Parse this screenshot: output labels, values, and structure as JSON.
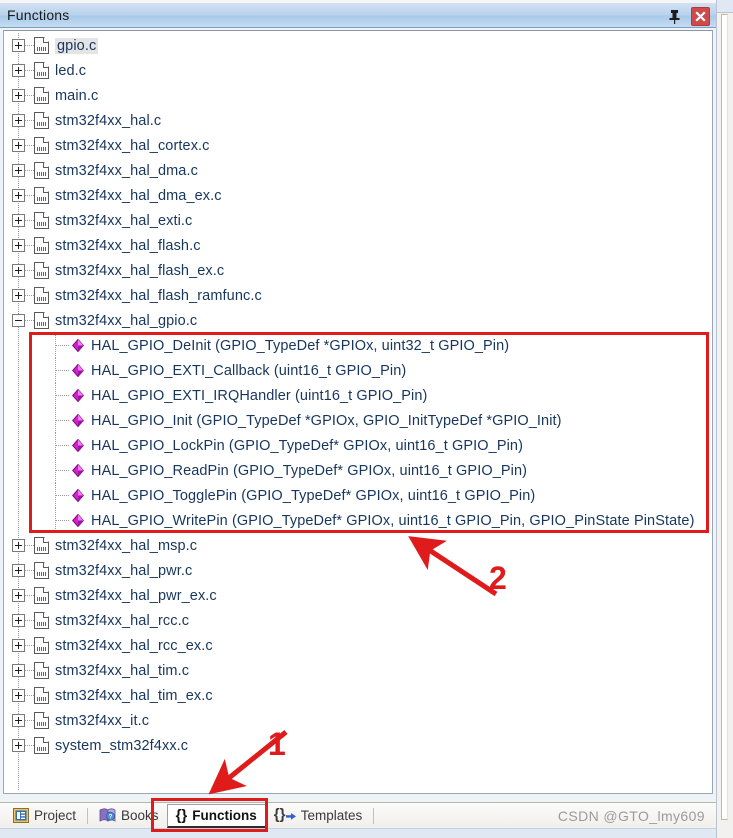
{
  "window": {
    "title": "Functions",
    "pin_icon": "pin-icon",
    "close_icon": "close-icon"
  },
  "tree": {
    "files": [
      {
        "label": "gpio.c",
        "expanded": false,
        "selected": true
      },
      {
        "label": "led.c",
        "expanded": false,
        "selected": false
      },
      {
        "label": "main.c",
        "expanded": false,
        "selected": false
      },
      {
        "label": "stm32f4xx_hal.c",
        "expanded": false,
        "selected": false
      },
      {
        "label": "stm32f4xx_hal_cortex.c",
        "expanded": false,
        "selected": false
      },
      {
        "label": "stm32f4xx_hal_dma.c",
        "expanded": false,
        "selected": false
      },
      {
        "label": "stm32f4xx_hal_dma_ex.c",
        "expanded": false,
        "selected": false
      },
      {
        "label": "stm32f4xx_hal_exti.c",
        "expanded": false,
        "selected": false
      },
      {
        "label": "stm32f4xx_hal_flash.c",
        "expanded": false,
        "selected": false
      },
      {
        "label": "stm32f4xx_hal_flash_ex.c",
        "expanded": false,
        "selected": false
      },
      {
        "label": "stm32f4xx_hal_flash_ramfunc.c",
        "expanded": false,
        "selected": false
      },
      {
        "label": "stm32f4xx_hal_gpio.c",
        "expanded": true,
        "selected": false
      },
      {
        "label": "stm32f4xx_hal_msp.c",
        "expanded": false,
        "selected": false
      },
      {
        "label": "stm32f4xx_hal_pwr.c",
        "expanded": false,
        "selected": false
      },
      {
        "label": "stm32f4xx_hal_pwr_ex.c",
        "expanded": false,
        "selected": false
      },
      {
        "label": "stm32f4xx_hal_rcc.c",
        "expanded": false,
        "selected": false
      },
      {
        "label": "stm32f4xx_hal_rcc_ex.c",
        "expanded": false,
        "selected": false
      },
      {
        "label": "stm32f4xx_hal_tim.c",
        "expanded": false,
        "selected": false
      },
      {
        "label": "stm32f4xx_hal_tim_ex.c",
        "expanded": false,
        "selected": false
      },
      {
        "label": "stm32f4xx_it.c",
        "expanded": false,
        "selected": false
      },
      {
        "label": "system_stm32f4xx.c",
        "expanded": false,
        "selected": false
      }
    ],
    "expanded_children": [
      "HAL_GPIO_DeInit (GPIO_TypeDef *GPIOx, uint32_t GPIO_Pin)",
      "HAL_GPIO_EXTI_Callback (uint16_t GPIO_Pin)",
      "HAL_GPIO_EXTI_IRQHandler (uint16_t GPIO_Pin)",
      "HAL_GPIO_Init (GPIO_TypeDef *GPIOx, GPIO_InitTypeDef *GPIO_Init)",
      "HAL_GPIO_LockPin (GPIO_TypeDef* GPIOx, uint16_t GPIO_Pin)",
      "HAL_GPIO_ReadPin (GPIO_TypeDef* GPIOx, uint16_t GPIO_Pin)",
      "HAL_GPIO_TogglePin (GPIO_TypeDef* GPIOx, uint16_t GPIO_Pin)",
      "HAL_GPIO_WritePin (GPIO_TypeDef* GPIOx, uint16_t GPIO_Pin, GPIO_PinState PinState)"
    ],
    "child_icon": "function-diamond-icon",
    "file_icon": "c-source-file-icon"
  },
  "tabs": [
    {
      "label": "Project",
      "icon": "project-icon",
      "active": false
    },
    {
      "label": "Books",
      "icon": "books-icon",
      "active": false
    },
    {
      "label": "Functions",
      "icon": "braces-icon",
      "active": true
    },
    {
      "label": "Templates",
      "icon": "braces-arrow-icon",
      "active": false
    }
  ],
  "annotations": {
    "num_1": "1",
    "num_2": "2",
    "box_color": "#e01b1b"
  },
  "watermark": "CSDN @GTO_lmy609"
}
